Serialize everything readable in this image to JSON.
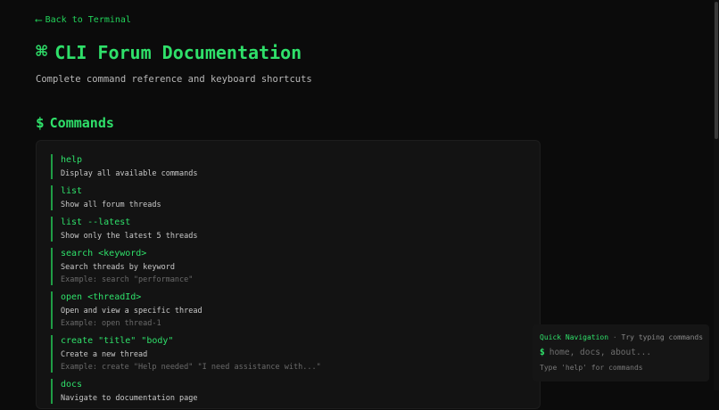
{
  "nav": {
    "back_arrow": "⟵",
    "back_label": "Back to Terminal"
  },
  "header": {
    "icon": "⌘",
    "title": "CLI Forum Documentation",
    "subtitle": "Complete command reference and keyboard shortcuts"
  },
  "commands_section": {
    "icon": "$",
    "title": "Commands",
    "items": [
      {
        "name": "help",
        "description": "Display all available commands",
        "example": ""
      },
      {
        "name": "list",
        "description": "Show all forum threads",
        "example": ""
      },
      {
        "name": "list --latest",
        "description": "Show only the latest 5 threads",
        "example": ""
      },
      {
        "name": "search <keyword>",
        "description": "Search threads by keyword",
        "example": "Example: search \"performance\""
      },
      {
        "name": "open <threadId>",
        "description": "Open and view a specific thread",
        "example": "Example: open thread-1"
      },
      {
        "name": "create \"title\" \"body\"",
        "description": "Create a new thread",
        "example": "Example: create \"Help needed\" \"I need assistance with...\""
      },
      {
        "name": "docs",
        "description": "Navigate to documentation page",
        "example": ""
      }
    ]
  },
  "quick_nav": {
    "title": "Quick Navigation",
    "separator": "·",
    "hint": "Try typing commands",
    "prompt": "$",
    "input_value": "",
    "input_placeholder": "home, docs, about...",
    "help_text": "Type 'help' for commands"
  },
  "colors": {
    "accent": "#2fe06a",
    "background": "#0b0b0b",
    "panel": "#131313"
  }
}
